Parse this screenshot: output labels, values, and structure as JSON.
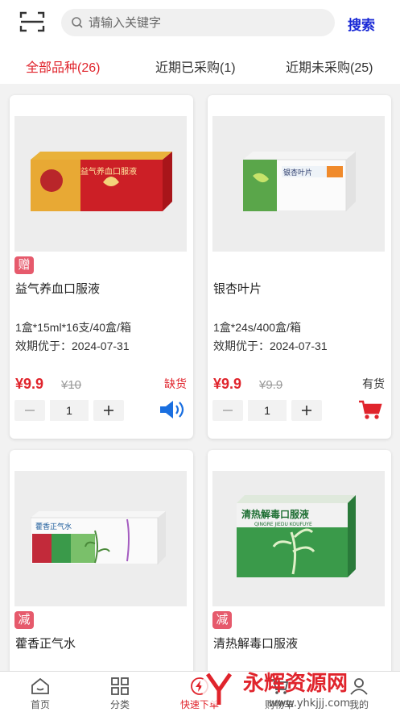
{
  "header": {
    "search_placeholder": "请输入关键字",
    "search_button": "搜索"
  },
  "tabs": [
    {
      "label": "全部品种(26)",
      "active": true
    },
    {
      "label": "近期已采购(1)",
      "active": false
    },
    {
      "label": "近期未采购(25)",
      "active": false
    }
  ],
  "products": [
    {
      "badge": "赠",
      "name": "益气养血口服液",
      "spec": "1盒*15ml*16支/40盒/箱",
      "expiry": "效期优于：2024-07-31",
      "price": "¥9.9",
      "original_price": "¥10",
      "stock": "缺货",
      "quantity": "1",
      "box_label": "益气养血口服液"
    },
    {
      "badge": "",
      "name": "银杏叶片",
      "spec": "1盒*24s/400盒/箱",
      "expiry": "效期优于：2024-07-31",
      "price": "¥9.9",
      "original_price": "¥9.9",
      "stock": "有货",
      "quantity": "1",
      "box_label": "银杏叶片"
    },
    {
      "badge": "减",
      "name": "藿香正气水",
      "box_label": "藿香正气水"
    },
    {
      "badge": "减",
      "name": "清热解毒口服液",
      "box_label": "清热解毒口服液",
      "box_sublabel": "QINGRE JIEDU KOUFUYE"
    }
  ],
  "bottom_nav": [
    {
      "label": "首页",
      "icon": "home-icon"
    },
    {
      "label": "分类",
      "icon": "grid-icon"
    },
    {
      "label": "快速下单",
      "icon": "lightning-icon",
      "active": true
    },
    {
      "label": "购物车",
      "icon": "cart-icon"
    },
    {
      "label": "我的",
      "icon": "user-icon"
    }
  ],
  "watermark": {
    "title": "永辉资源网",
    "url": "www.yhkjjj.com"
  },
  "colors": {
    "accent": "#e0242c",
    "search": "#1a2ad6",
    "badge": "#e65a6c",
    "sound": "#1a6fe0"
  }
}
